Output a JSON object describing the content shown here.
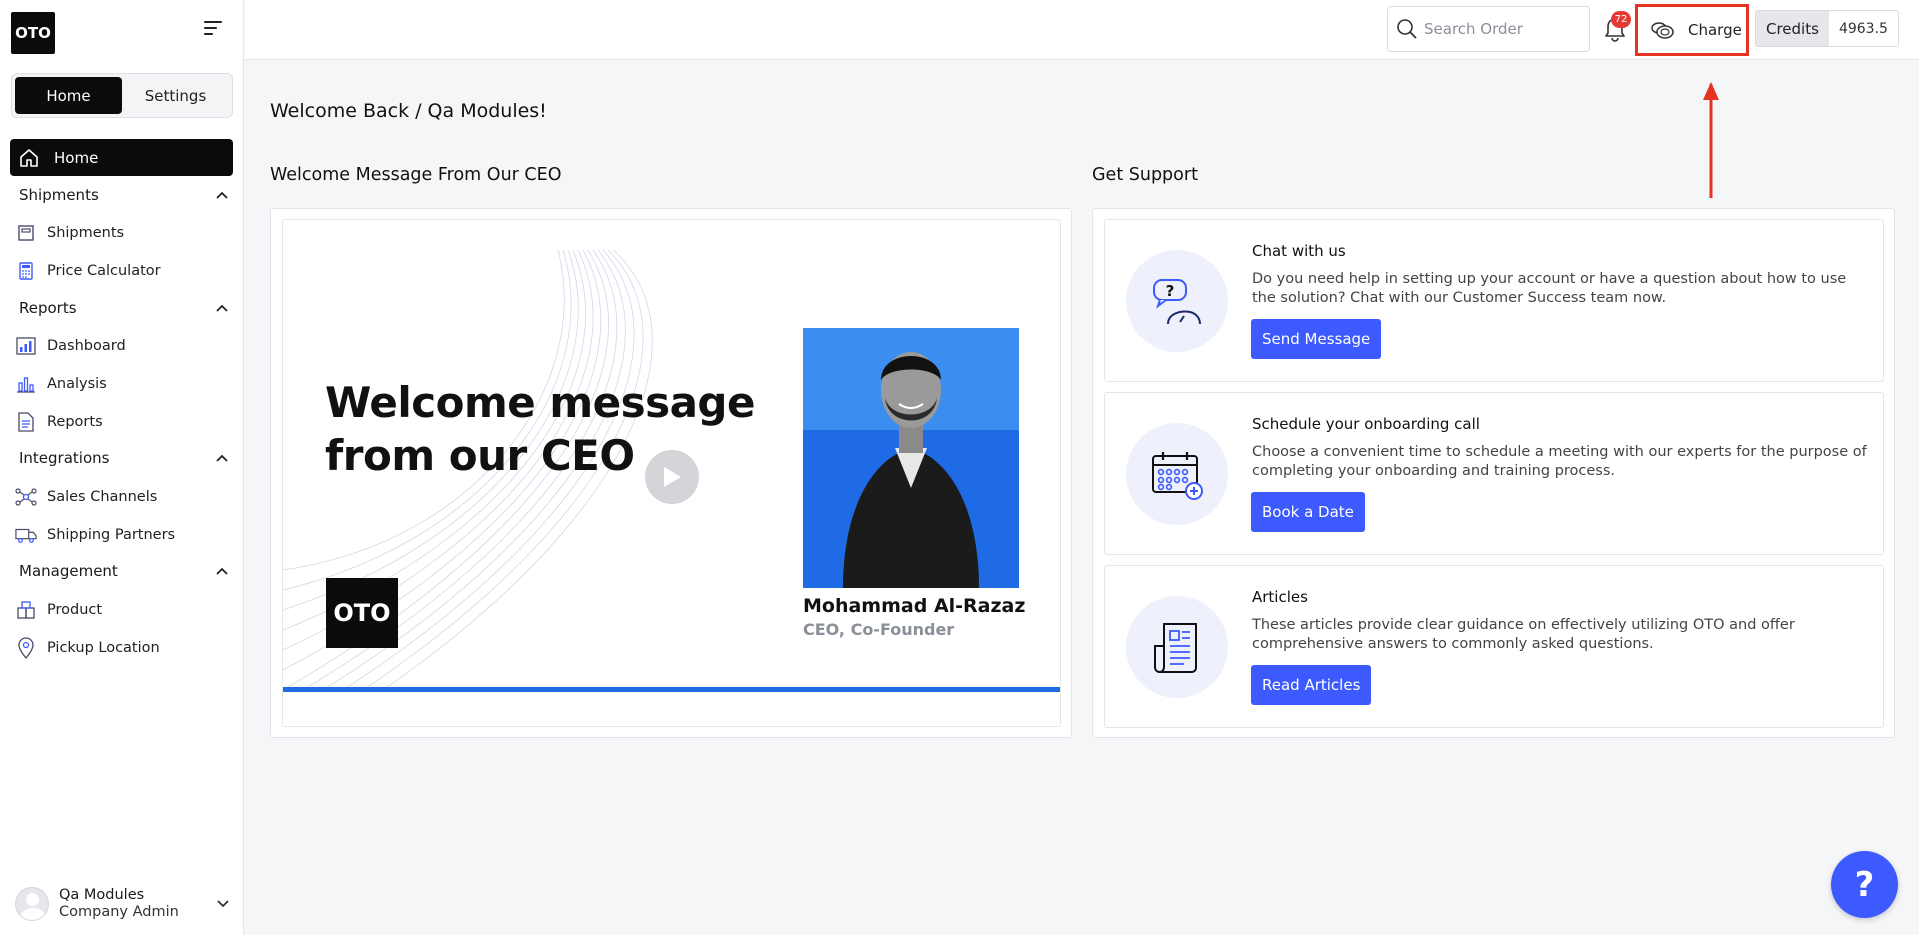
{
  "app": {
    "logo_text": "OTO"
  },
  "sidebar": {
    "tabs": [
      {
        "label": "Home",
        "active": true
      },
      {
        "label": "Settings",
        "active": false
      }
    ],
    "home_label": "Home",
    "groups": {
      "shipments": {
        "label": "Shipments",
        "items": [
          "Shipments",
          "Price Calculator"
        ]
      },
      "reports": {
        "label": "Reports",
        "items": [
          "Dashboard",
          "Analysis",
          "Reports"
        ]
      },
      "integrations": {
        "label": "Integrations",
        "items": [
          "Sales Channels",
          "Shipping Partners"
        ]
      },
      "management": {
        "label": "Management",
        "items": [
          "Product",
          "Pickup Location"
        ]
      }
    },
    "user": {
      "name": "Qa Modules",
      "role": "Company Admin"
    }
  },
  "topbar": {
    "search_placeholder": "Search Order",
    "notification_count": "72",
    "charge_label": "Charge",
    "credits_label": "Credits",
    "credits_value": "4963.5"
  },
  "main": {
    "welcome": "Welcome Back / Qa Modules!",
    "ceo_section_title": "Welcome Message From Our CEO",
    "support_section_title": "Get Support",
    "ceo_card": {
      "headline_line1": "Welcome message",
      "headline_line2": "from our CEO",
      "logo_text": "OTO",
      "name": "Mohammad Al-Razaz",
      "role": "CEO, Co-Founder"
    },
    "support": [
      {
        "title": "Chat with us",
        "desc": "Do you need help in setting up your account or have a question about how to use the solution? Chat with our Customer Success team now.",
        "button": "Send Message",
        "icon": "chat-icon"
      },
      {
        "title": "Schedule your onboarding call",
        "desc": "Choose a convenient time to schedule a meeting with our experts for the purpose of completing your onboarding and training process.",
        "button": "Book a Date",
        "icon": "calendar-icon"
      },
      {
        "title": "Articles",
        "desc": "These articles provide clear guidance on effectively utilizing OTO and offer comprehensive answers to commonly asked questions.",
        "button": "Read Articles",
        "icon": "article-icon"
      }
    ]
  },
  "help_button": "?",
  "colors": {
    "accent": "#3d5afe",
    "dark": "#0b0b0b",
    "highlight": "#e53322",
    "ceo_blue": "#1f6be5"
  }
}
